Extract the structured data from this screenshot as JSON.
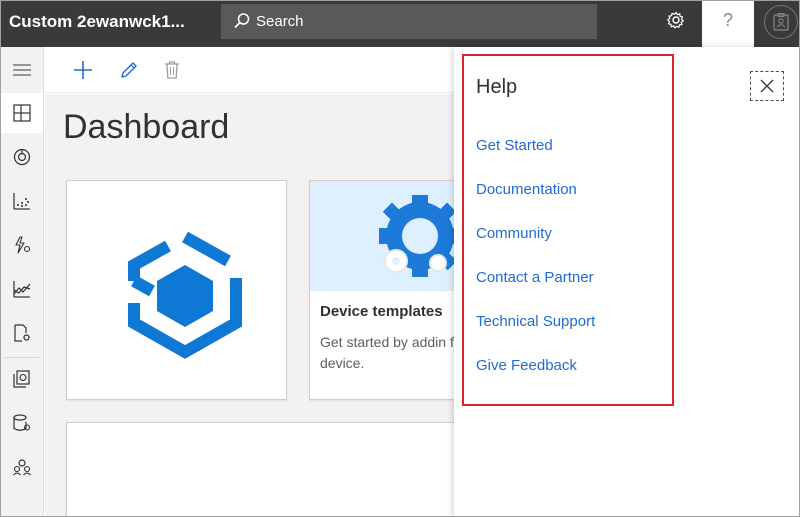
{
  "app": {
    "title": "Custom 2ewanwck1..."
  },
  "search": {
    "label": "Search"
  },
  "header": {
    "help_glyph": "?"
  },
  "main": {
    "page_title": "Dashboard"
  },
  "cards": {
    "device_templates": {
      "heading": "Device templates",
      "description": "Get started by addin first device."
    }
  },
  "help_panel": {
    "title": "Help",
    "links": [
      "Get Started",
      "Documentation",
      "Community",
      "Contact a Partner",
      "Technical Support",
      "Give Feedback"
    ]
  },
  "colors": {
    "topbar": "#3b3a39",
    "accent_blue": "#1f6bd0",
    "logo_blue": "#0f78d4",
    "highlight_red": "#d9262e",
    "nav_bg": "#f3f2f1"
  },
  "icons": {
    "top": [
      "search-icon",
      "gear-icon",
      "help-icon",
      "avatar-icon"
    ],
    "nav": [
      "hamburger-icon",
      "dashboard-icon",
      "device-icon",
      "analytics-icon",
      "rules-icon",
      "chart-icon",
      "jobs-icon",
      "device-templates-icon",
      "data-export-icon",
      "users-icon"
    ],
    "toolbar": [
      "add-icon",
      "edit-icon",
      "delete-icon"
    ],
    "panel": [
      "close-icon"
    ]
  }
}
